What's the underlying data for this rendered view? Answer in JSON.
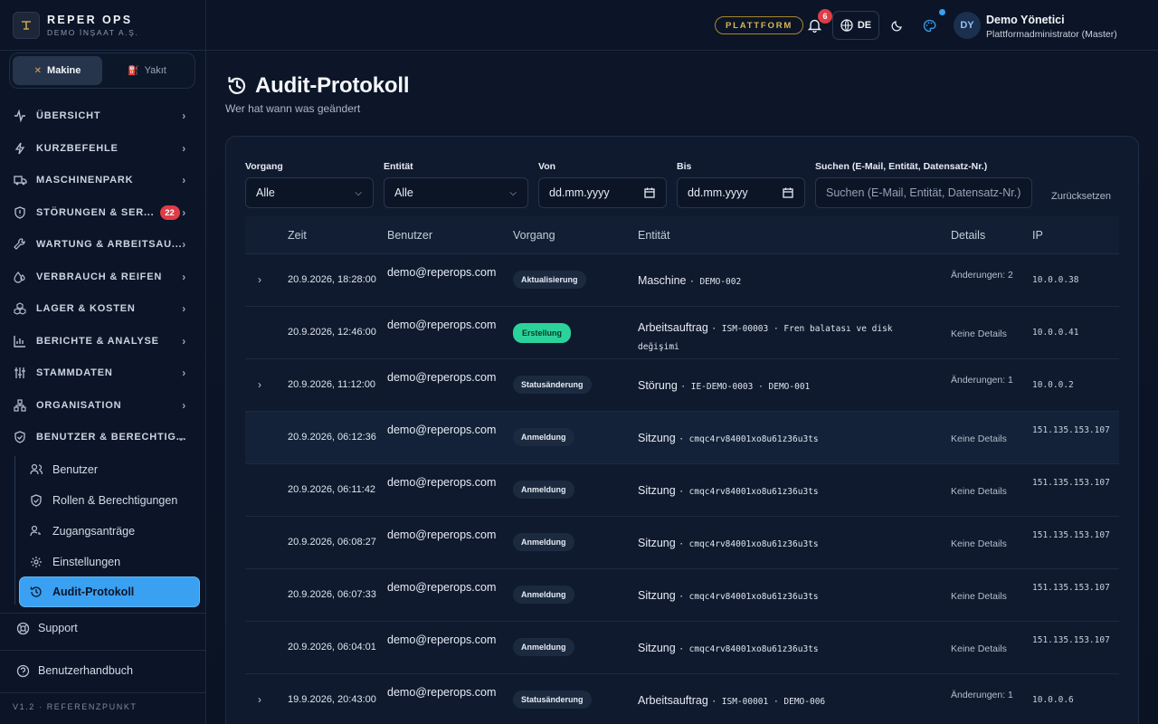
{
  "brand": {
    "name": "REPER OPS",
    "subtitle": "DEMO İNŞAAT A.Ş."
  },
  "switcher": [
    {
      "label": "Makine",
      "active": true,
      "icon": "excavator-icon"
    },
    {
      "label": "Yakıt",
      "active": false,
      "icon": "fuel-icon"
    }
  ],
  "sidebar": {
    "items": [
      {
        "label": "ÜBERSICHT",
        "icon": "activity-icon"
      },
      {
        "label": "KURZBEFEHLE",
        "icon": "bolt-icon"
      },
      {
        "label": "MASCHINENPARK",
        "icon": "truck-icon"
      },
      {
        "label": "STÖRUNGEN & SER...",
        "icon": "shield-alert-icon",
        "badge": "22"
      },
      {
        "label": "WARTUNG & ARBEITSAU...",
        "icon": "wrench-icon"
      },
      {
        "label": "VERBRAUCH & REIFEN",
        "icon": "droplet-icon"
      },
      {
        "label": "LAGER & KOSTEN",
        "icon": "boxes-icon"
      },
      {
        "label": "BERICHTE & ANALYSE",
        "icon": "bar-chart-icon"
      },
      {
        "label": "STAMMDATEN",
        "icon": "sliders-icon"
      },
      {
        "label": "ORGANISATION",
        "icon": "org-icon"
      },
      {
        "label": "BENUTZER & BERECHTIG...",
        "icon": "shield-check-icon",
        "expanded": true
      }
    ],
    "subitems": [
      {
        "label": "Benutzer",
        "icon": "users-icon"
      },
      {
        "label": "Rollen & Berechtigungen",
        "icon": "shield-icon"
      },
      {
        "label": "Zugangsanträge",
        "icon": "user-clock-icon"
      },
      {
        "label": "Einstellungen",
        "icon": "gear-icon"
      },
      {
        "label": "Audit-Protokoll",
        "icon": "history-icon",
        "active": true
      }
    ],
    "support": "Support",
    "manual": "Benutzerhandbuch",
    "version": "V1.2 · REFERENZPUNKT"
  },
  "topbar": {
    "platform": "PLATTFORM",
    "notifications": "6",
    "lang": "DE",
    "avatar": "DY",
    "user_name": "Demo Yönetici",
    "user_role": "Plattformadministrator (Master)"
  },
  "page": {
    "title": "Audit-Protokoll",
    "subtitle": "Wer hat wann was geändert"
  },
  "filters": {
    "op_label": "Vorgang",
    "op_value": "Alle",
    "entity_label": "Entität",
    "entity_value": "Alle",
    "from_label": "Von",
    "from_value": "dd.mm.yyyy",
    "to_label": "Bis",
    "to_value": "dd.mm.yyyy",
    "search_label": "Suchen (E-Mail, Entität, Datensatz-Nr.)",
    "search_placeholder": "Suchen (E-Mail, Entität, Datensatz-Nr.)",
    "reset": "Zurücksetzen"
  },
  "table": {
    "headers": [
      "Zeit",
      "Benutzer",
      "Vorgang",
      "Entität",
      "Details",
      "IP"
    ],
    "rows": [
      {
        "expand": true,
        "time": "20.9.2026, 18:28:00",
        "user": "demo@reperops.com",
        "op": "Aktualisierung",
        "op_style": "dark",
        "entity": "Maschine",
        "ref": "DEMO-002",
        "details": "Änderungen: 2",
        "ip": "10.0.0.38"
      },
      {
        "expand": false,
        "time": "20.9.2026, 12:46:00",
        "user": "demo@reperops.com",
        "op": "Erstellung",
        "op_style": "green",
        "entity": "Arbeitsauftrag",
        "ref": "ISM-00003 · Fren balatası ve disk değişimi",
        "details": "Keine Details",
        "ip": "10.0.0.41"
      },
      {
        "expand": true,
        "time": "20.9.2026, 11:12:00",
        "user": "demo@reperops.com",
        "op": "Statusänderung",
        "op_style": "dark",
        "entity": "Störung",
        "ref": "IE-DEMO-0003 · DEMO-001",
        "details": "Änderungen: 1",
        "ip": "10.0.0.2"
      },
      {
        "expand": false,
        "time": "20.9.2026, 06:12:36",
        "user": "demo@reperops.com",
        "op": "Anmeldung",
        "op_style": "dark",
        "entity": "Sitzung",
        "ref": "cmqc4rv84001xo8u61z36u3ts",
        "details": "Keine Details",
        "ip": "151.135.153.107"
      },
      {
        "expand": false,
        "time": "20.9.2026, 06:11:42",
        "user": "demo@reperops.com",
        "op": "Anmeldung",
        "op_style": "dark",
        "entity": "Sitzung",
        "ref": "cmqc4rv84001xo8u61z36u3ts",
        "details": "Keine Details",
        "ip": "151.135.153.107"
      },
      {
        "expand": false,
        "time": "20.9.2026, 06:08:27",
        "user": "demo@reperops.com",
        "op": "Anmeldung",
        "op_style": "dark",
        "entity": "Sitzung",
        "ref": "cmqc4rv84001xo8u61z36u3ts",
        "details": "Keine Details",
        "ip": "151.135.153.107"
      },
      {
        "expand": false,
        "time": "20.9.2026, 06:07:33",
        "user": "demo@reperops.com",
        "op": "Anmeldung",
        "op_style": "dark",
        "entity": "Sitzung",
        "ref": "cmqc4rv84001xo8u61z36u3ts",
        "details": "Keine Details",
        "ip": "151.135.153.107"
      },
      {
        "expand": false,
        "time": "20.9.2026, 06:04:01",
        "user": "demo@reperops.com",
        "op": "Anmeldung",
        "op_style": "dark",
        "entity": "Sitzung",
        "ref": "cmqc4rv84001xo8u61z36u3ts",
        "details": "Keine Details",
        "ip": "151.135.153.107"
      },
      {
        "expand": true,
        "time": "19.9.2026, 20:43:00",
        "user": "demo@reperops.com",
        "op": "Statusänderung",
        "op_style": "dark",
        "entity": "Arbeitsauftrag",
        "ref": "ISM-00001 · DEMO-006",
        "details": "Änderungen: 1",
        "ip": "10.0.0.6"
      }
    ]
  },
  "colors": {
    "accent": "#3aa0f2",
    "badge": "#e03c46",
    "success": "#2bd39a",
    "gold": "#d9b458"
  }
}
